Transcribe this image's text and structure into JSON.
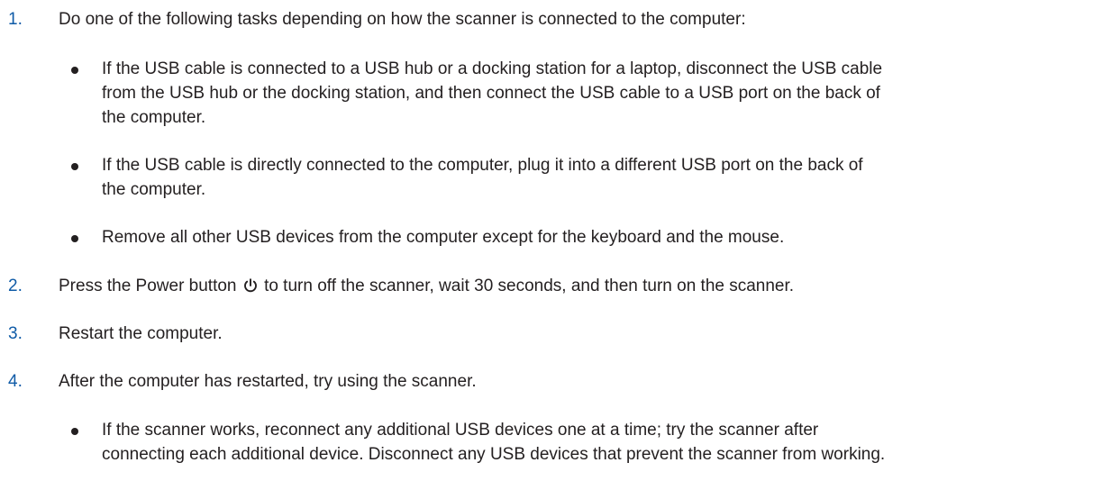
{
  "steps": [
    {
      "number": "1.",
      "text": "Do one of the following tasks depending on how the scanner is connected to the computer:",
      "bullets": [
        {
          "lines": [
            "If the USB cable is connected to a USB hub or a docking station for a laptop, disconnect the USB cable",
            "from the USB hub or the docking station, and then connect the USB cable to a USB port on the back of",
            "the computer."
          ]
        },
        {
          "lines": [
            "If the USB cable is directly connected to the computer, plug it into a different USB port on the back of",
            "the computer."
          ]
        },
        {
          "lines": [
            "Remove all other USB devices from the computer except for the keyboard and the mouse."
          ]
        }
      ]
    },
    {
      "number": "2.",
      "text_before_icon": "Press the Power button",
      "icon": "power-icon",
      "text_after_icon": "to turn off the scanner, wait 30 seconds, and then turn on the scanner."
    },
    {
      "number": "3.",
      "text": "Restart the computer."
    },
    {
      "number": "4.",
      "text": "After the computer has restarted, try using the scanner.",
      "bullets": [
        {
          "lines": [
            "If the scanner works, reconnect any additional USB devices one at a time; try the scanner after",
            "connecting each additional device. Disconnect any USB devices that prevent the scanner from working."
          ]
        }
      ]
    }
  ],
  "colors": {
    "step_number": "#0f5ba7",
    "body_text": "#231f20"
  }
}
